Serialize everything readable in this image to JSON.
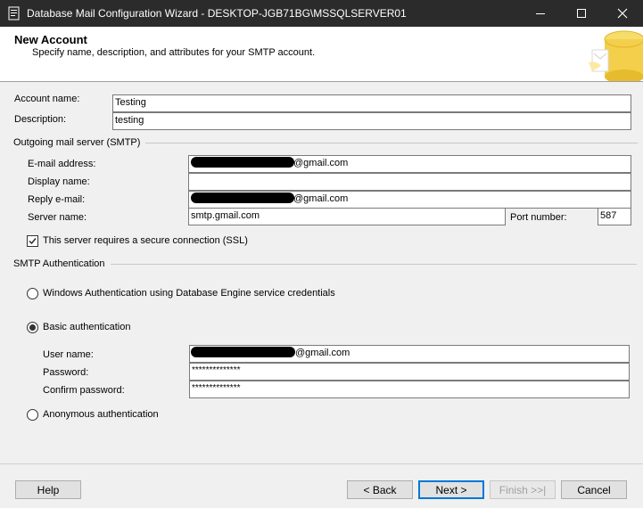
{
  "window": {
    "title": "Database Mail Configuration Wizard - DESKTOP-JGB71BG\\MSSQLSERVER01",
    "icons": [
      "app-icon",
      "minimize-icon",
      "maximize-icon",
      "close-icon"
    ]
  },
  "header": {
    "title": "New Account",
    "subtitle": "Specify name, description, and attributes for your SMTP account."
  },
  "account": {
    "name_label": "Account name:",
    "name_value": "Testing",
    "description_label": "Description:",
    "description_value": "testing"
  },
  "smtp": {
    "group_label": "Outgoing mail server (SMTP)",
    "email_label": "E-mail address:",
    "email_value": "@gmail.com",
    "display_name_label": "Display name:",
    "display_name_value": "",
    "reply_email_label": "Reply e-mail:",
    "reply_email_value": "@gmail.com",
    "server_label": "Server name:",
    "server_value": "smtp.gmail.com",
    "port_label": "Port number:",
    "port_value": "587",
    "ssl_label": "This server requires a secure connection (SSL)",
    "ssl_checked": true
  },
  "auth": {
    "group_label": "SMTP Authentication",
    "windows_label": "Windows Authentication using Database Engine service credentials",
    "basic_label": "Basic authentication",
    "selected": "basic",
    "user_label": "User name:",
    "user_value": "@gmail.com",
    "password_label": "Password:",
    "password_value": "**************",
    "confirm_label": "Confirm password:",
    "confirm_value": "**************",
    "anonymous_label": "Anonymous authentication"
  },
  "buttons": {
    "help": "Help",
    "back": "< Back",
    "next": "Next >",
    "finish": "Finish >>|",
    "cancel": "Cancel"
  },
  "colors": {
    "titlebar": "#2b2b2b",
    "focus_border": "#0078d7"
  }
}
